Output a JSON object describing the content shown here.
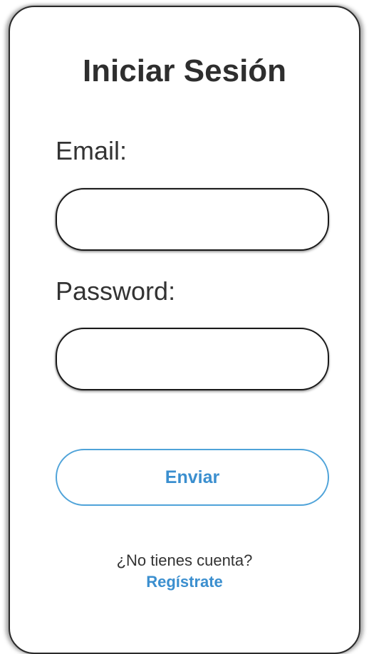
{
  "form": {
    "title": "Iniciar Sesión",
    "email_label": "Email:",
    "email_value": "",
    "password_label": "Password:",
    "password_value": "",
    "submit_label": "Enviar"
  },
  "footer": {
    "prompt": "¿No tienes cuenta?",
    "register_link": "Regístrate"
  },
  "colors": {
    "accent": "#4fa3d9",
    "text": "#333333",
    "border": "#1a1a1a"
  }
}
